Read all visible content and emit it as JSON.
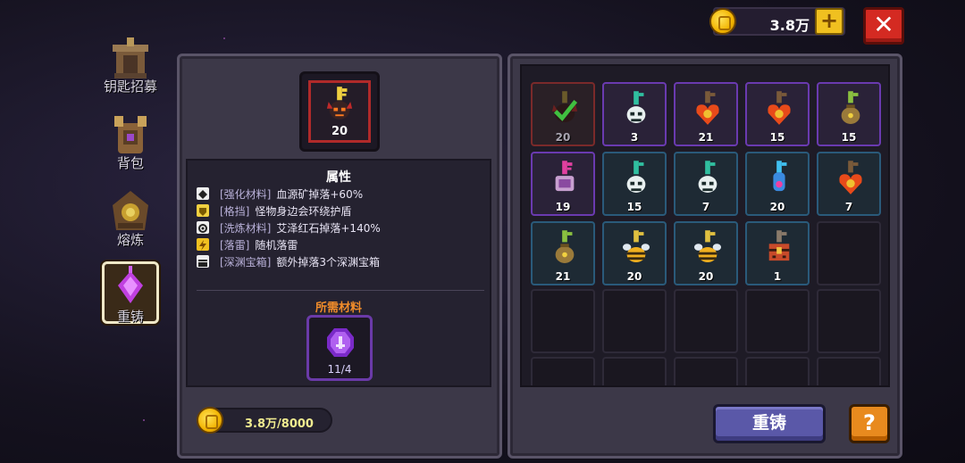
{
  "currency": {
    "amount": "3.8万",
    "plus_symbol": "+",
    "close_symbol": "✕"
  },
  "nav": {
    "items": [
      {
        "label": "钥匙招募",
        "icon": "shrine-icon"
      },
      {
        "label": "背包",
        "icon": "backpack-icon"
      },
      {
        "label": "熔炼",
        "icon": "furnace-icon"
      },
      {
        "label": "重铸",
        "icon": "reforge-icon"
      }
    ],
    "active_index": 3
  },
  "selected_item": {
    "count": "20",
    "icon": "demon-key-icon"
  },
  "attributes": {
    "title": "属性",
    "rows": [
      {
        "tag": "[强化材料]",
        "desc": "血源矿掉落+60%",
        "icon": "diamond-icon"
      },
      {
        "tag": "[格挡]",
        "desc": "怪物身边会环绕护盾",
        "icon": "shield-icon"
      },
      {
        "tag": "[洗炼材料]",
        "desc": "艾泽红石掉落+140%",
        "icon": "gear-icon"
      },
      {
        "tag": "[落雷]",
        "desc": "随机落雷",
        "icon": "lightning-icon"
      },
      {
        "tag": "[深渊宝箱]",
        "desc": "额外掉落3个深渊宝箱",
        "icon": "chest-icon"
      }
    ]
  },
  "required_materials": {
    "title": "所需材料",
    "count": "11/4",
    "icon": "purple-gem-icon"
  },
  "cost": {
    "text": "3.8万/8000"
  },
  "inventory": {
    "slots": [
      {
        "count": "20",
        "style": "red",
        "icon": "demon-key-selected-icon"
      },
      {
        "count": "3",
        "style": "purple",
        "icon": "skull-key-icon"
      },
      {
        "count": "21",
        "style": "purple",
        "icon": "heart-key-icon"
      },
      {
        "count": "15",
        "style": "purple",
        "icon": "heart-key-icon"
      },
      {
        "count": "15",
        "style": "purple",
        "icon": "bag-key-icon"
      },
      {
        "count": "19",
        "style": "purple",
        "icon": "pink-key-icon"
      },
      {
        "count": "15",
        "style": "blue",
        "icon": "skull-key-icon"
      },
      {
        "count": "7",
        "style": "blue",
        "icon": "skull-key-icon"
      },
      {
        "count": "20",
        "style": "blue",
        "icon": "crystal-key-icon"
      },
      {
        "count": "7",
        "style": "blue",
        "icon": "heart-key-icon"
      },
      {
        "count": "21",
        "style": "blue",
        "icon": "bag-key-icon"
      },
      {
        "count": "20",
        "style": "blue",
        "icon": "bee-key-icon"
      },
      {
        "count": "20",
        "style": "blue",
        "icon": "bee-key-icon"
      },
      {
        "count": "1",
        "style": "blue",
        "icon": "chest-key-icon"
      }
    ]
  },
  "buttons": {
    "reforge": "重铸",
    "help": "?"
  },
  "colors": {
    "accent_orange": "#f08c2a",
    "rarity_red": "#b02a2a",
    "rarity_purple": "#6a3ab0",
    "rarity_blue": "#2a5a7a"
  }
}
